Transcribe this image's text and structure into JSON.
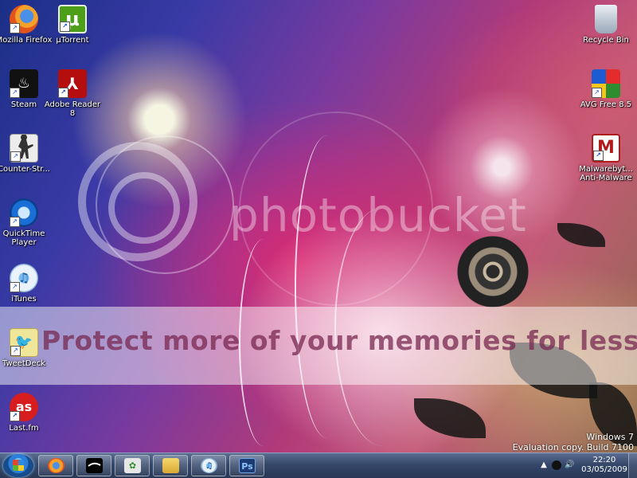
{
  "desktop": {
    "icons_left": [
      {
        "id": "firefox",
        "label": "Mozilla Firefox",
        "glyph": ""
      },
      {
        "id": "utorrent",
        "label": "µTorrent",
        "glyph": "µ"
      },
      {
        "id": "steam",
        "label": "Steam",
        "glyph": "♨"
      },
      {
        "id": "adobe",
        "label": "Adobe Reader 8",
        "glyph": "⅄"
      },
      {
        "id": "cs",
        "label": "Counter-Str...",
        "glyph": ""
      },
      {
        "id": "quicktime",
        "label": "QuickTime Player",
        "glyph": ""
      },
      {
        "id": "itunes",
        "label": "iTunes",
        "glyph": "♫"
      },
      {
        "id": "tweetdeck",
        "label": "TweetDeck",
        "glyph": "🐦"
      },
      {
        "id": "lastfm",
        "label": "Last.fm",
        "glyph": "as"
      }
    ],
    "icons_right": [
      {
        "id": "recycle",
        "label": "Recycle Bin"
      },
      {
        "id": "avg",
        "label": "AVG Free 8.5"
      },
      {
        "id": "malwarebytes",
        "label": "Malwarebyt... Anti-Malware",
        "glyph": "M"
      }
    ],
    "watermark": {
      "brand": "photobucket",
      "slogan": "Protect more of your memories for less!"
    },
    "os_version": {
      "line1": "Windows 7",
      "line2": "Evaluation copy. Build 7100"
    }
  },
  "taskbar": {
    "pinned": [
      {
        "id": "firefox",
        "glyph": ""
      },
      {
        "id": "steam",
        "glyph": ""
      },
      {
        "id": "messenger",
        "glyph": "✿"
      },
      {
        "id": "explorer",
        "glyph": ""
      },
      {
        "id": "itunes",
        "glyph": "♫"
      },
      {
        "id": "photoshop",
        "glyph": "Ps"
      }
    ],
    "tray": {
      "arrow_glyph": "▲",
      "volume_glyph": "🔊",
      "time": "22:20",
      "date": "03/05/2009"
    }
  },
  "colors": {
    "taskbar": "#35486a",
    "accent": "#2b7fd8"
  }
}
